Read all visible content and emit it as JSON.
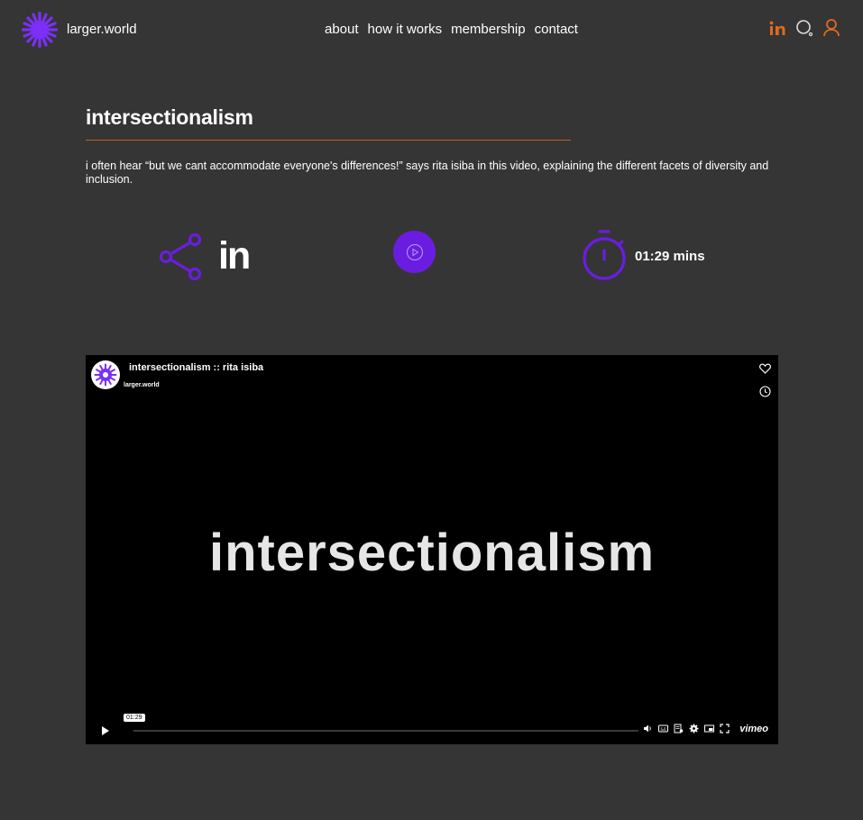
{
  "header": {
    "brand": "larger.world",
    "nav": [
      "about",
      "how it works",
      "membership",
      "contact"
    ],
    "icons": [
      "linkedin-icon",
      "search-icon",
      "user-icon"
    ],
    "accent": "#e06a1c",
    "logo_color": "#7b2ff7"
  },
  "article": {
    "title": "intersectionalism",
    "description": "i often hear “but we cant accommodate everyone's differences!” says rita isiba in this video, explaining the different facets of diversity and inclusion.",
    "share_label": "in",
    "duration": "01:29 mins",
    "accent": "#6a1de0"
  },
  "video": {
    "title": "intersectionalism :: rita isiba",
    "byline": "larger.world",
    "center_text": "intersectionalism",
    "timestamp": "01:29",
    "player_brand": "vimeo",
    "progress": 0
  }
}
